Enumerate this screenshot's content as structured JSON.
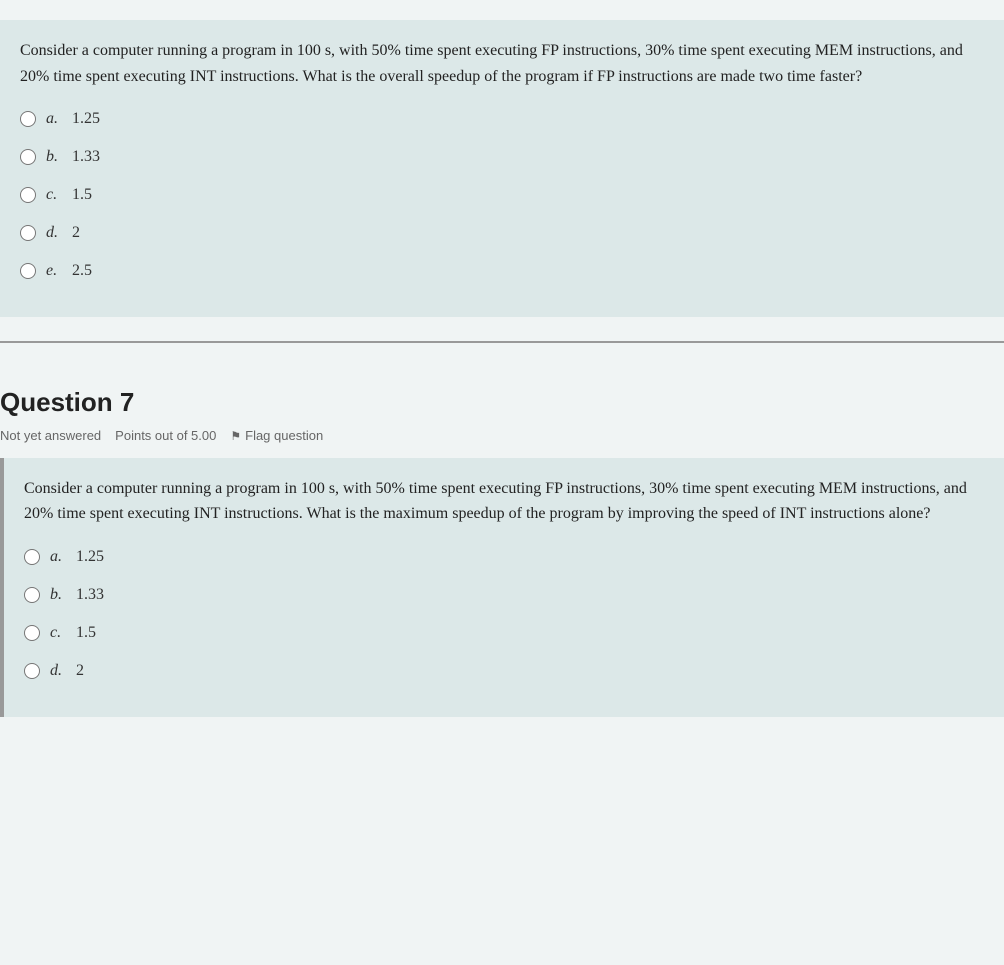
{
  "question6": {
    "content_box_bg": "#dce8e8",
    "text": "Consider a computer running a program in 100 s, with 50% time spent executing FP instructions, 30% time spent executing MEM instructions, and 20% time spent executing INT instructions. What is the overall speedup of the program if FP instructions are made two time faster?",
    "options": [
      {
        "label": "a.",
        "value": "1.25"
      },
      {
        "label": "b.",
        "value": "1.33"
      },
      {
        "label": "c.",
        "value": "1.5"
      },
      {
        "label": "d.",
        "value": "2"
      },
      {
        "label": "e.",
        "value": "2.5"
      }
    ]
  },
  "question7": {
    "title": "Question 7",
    "status": "Not yet answered",
    "points": "Points out of 5.00",
    "flag_label": "Flag question",
    "flag_icon": "⚑",
    "content_box_bg": "#dce8e8",
    "text": "Consider a computer running a program in 100 s, with 50% time spent executing FP instructions, 30% time spent executing MEM instructions, and 20% time spent executing INT instructions. What is the maximum speedup of the program by improving the speed of INT instructions alone?",
    "options": [
      {
        "label": "a.",
        "value": "1.25"
      },
      {
        "label": "b.",
        "value": "1.33"
      },
      {
        "label": "c.",
        "value": "1.5"
      },
      {
        "label": "d.",
        "value": "2"
      }
    ]
  }
}
